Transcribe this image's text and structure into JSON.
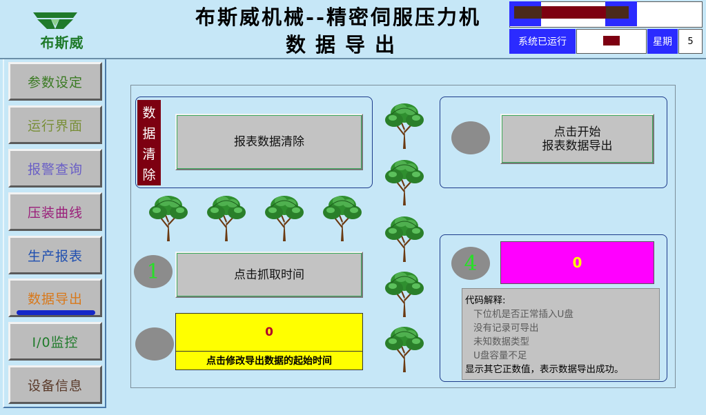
{
  "header": {
    "logo_text": "布斯威",
    "title_main": "布斯威机械--精密伺服压力机",
    "title_sub": "数据导出",
    "run_label": "系统已运行",
    "week_label": "星期",
    "week_value": "5"
  },
  "sidebar": {
    "items": [
      {
        "label": "参数设定",
        "color": "#3a7a22"
      },
      {
        "label": "运行界面",
        "color": "#7a8f3a"
      },
      {
        "label": "报警查询",
        "color": "#6a5fc6"
      },
      {
        "label": "压装曲线",
        "color": "#9a1f7a"
      },
      {
        "label": "生产报表",
        "color": "#1f4fb0"
      },
      {
        "label": "数据导出",
        "color": "#d8781a"
      },
      {
        "label": "I/0监控",
        "color": "#1f7a2a"
      },
      {
        "label": "设备信息",
        "color": "#5a3a2a"
      }
    ]
  },
  "clear_group": {
    "vertical_label": "数据清除",
    "clear_button": "报表数据清除"
  },
  "time_group": {
    "step_number": "1",
    "grab_button": "点击抓取时间",
    "time_value": "0",
    "time_caption": "点击修改导出数据的起始时间"
  },
  "export_group": {
    "export_button_line1": "点击开始",
    "export_button_line2": "报表数据导出"
  },
  "result_group": {
    "step_number": "4",
    "result_value": "0",
    "codes_title": "代码解释:",
    "codes": [
      "下位机是否正常插入U盘",
      "没有记录可导出",
      "未知数据类型",
      "U盘容量不足"
    ],
    "codes_footer": "显示其它正数值，表示数据导出成功。"
  },
  "colors": {
    "background": "#c6e7f7",
    "accent_blue": "#2b2bff",
    "dark_red": "#7d0011",
    "step_green": "#27e027"
  }
}
